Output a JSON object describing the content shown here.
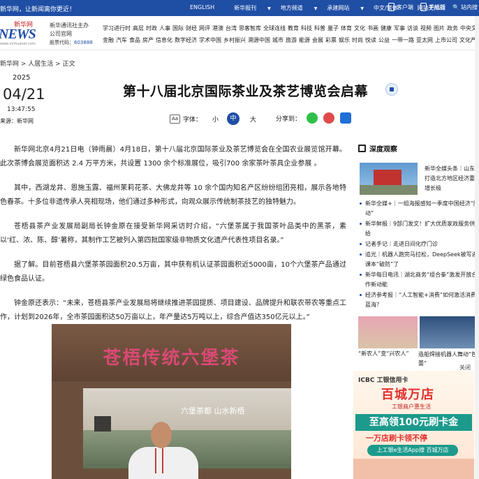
{
  "topbar": {
    "welcome": "新华网，让新闻离你更近！",
    "links": [
      "ENGLISH",
      "新华报刊",
      "地方频道",
      "承建网站",
      "中文/繁体",
      "网站无障碍"
    ],
    "apps": [
      "客户端",
      "手机版",
      "站内搜"
    ]
  },
  "brand": {
    "xhw": "新华网",
    "news": "NEWS",
    "url": "www.xinhuanet.com",
    "agency": "新华通讯社主办",
    "official": "公司官网",
    "code_label": "股票代码：",
    "code": "603888"
  },
  "channels": {
    "row1": [
      "学习进行时",
      "高层",
      "时政",
      "人事",
      "国际",
      "财经",
      "网评",
      "港澳",
      "台湾",
      "思客智库",
      "全球连线",
      "教育",
      "科技",
      "科普",
      "量子",
      "体育",
      "文化",
      "书画",
      "健康",
      "军事",
      "访谈",
      "视频",
      "图片",
      "政务",
      "中央文件"
    ],
    "row2": [
      "金融",
      "汽车",
      "食品",
      "房产",
      "信息化",
      "数字经济",
      "学术中国",
      "乡村振兴",
      "溯源中国",
      "城市",
      "旅游",
      "能源",
      "会展",
      "彩票",
      "娱乐",
      "时尚",
      "悦读",
      "公益",
      "一带一路",
      "亚太网",
      "上市公司",
      "文化产业"
    ]
  },
  "breadcrumb": [
    "新华网",
    "人居生活",
    "正文"
  ],
  "date": {
    "year": "2025",
    "md": "04/21",
    "time": "13:47:55",
    "source": "来源：新华网"
  },
  "article": {
    "title": "第十八届北京国际茶业及茶艺博览会启幕",
    "font_label": "字体：",
    "font_small": "小",
    "font_mid": "中",
    "font_large": "大",
    "share_label": "分享到：",
    "paragraphs": [
      "新华网北京4月21日电（钟雨晨）4月18日，第十八届北京国际茶业及茶艺博览会在全国农业展览馆开幕。此次茶博会展览面积达 2.4 万平方米，共设置 1300 余个标准展位，吸引700 余家茶叶茶具企业参展 。",
      "其中，西湖龙井、恩施玉露、福州茉莉花茶、大佛龙井等 10 余个国内知名产区纷纷组团亮相，展示各地特色春茶。十多位非遗传承人亮相现场，他们通过多种形式，向观众展示传统制茶技艺的独特魅力。",
      "苍梧县茶产业发展局副局长钟金原在接受新华网采访时介绍，“六堡茶属于我国茶叶品类中的黑茶，素以‘红、浓、陈、醇’著称，其制作工艺被列入第四批国家级非物质文化遗产代表性项目名录。”",
      "据了解。目前苍梧县六堡茶茶园面积20.5万亩，其中获有机认证茶园面积近5000亩，10个六堡茶产品通过绿色食品认证。",
      "钟金原还表示：“未来，苍梧县茶产业发展局将继续推进茶园提质、项目建设、品牌提升和联农带农等重点工作，计划到2026年，全市茶园面积达50万亩以上，年产量达5万吨以上，综合产值达350亿元以上。”"
    ],
    "photo_banner": "苍梧传统六堡茶",
    "photo_screen": "六堡茶都 山水新梧"
  },
  "sidebar": {
    "heading": "深度观察",
    "top_text": "新华全媒头条｜山东：打造北方地区经济重要增长极",
    "items": [
      "新华全媒+｜一组海报感知一季度中国经济“脉动”",
      "新华鲜报｜9部门发文！扩大优质家政服务供给",
      "记者手记｜走进日间化疗门诊",
      "追光｜机器人跑完马拉松，DeepSeek被写进课本“破防”了",
      "新华每日电讯｜湖北商务“组合拳”激发开放合作新动能",
      "经济参考报｜“人工智能+消费”如何激活消费蓝海？"
    ],
    "cap_a": "“新农人”变“兴农人”",
    "cap_b": "造船焊接机器人舞动“芭蕾”",
    "close": "关闭",
    "ad": {
      "brand": "ICBC 工银信用卡",
      "slogan": "百城万店",
      "sub": "工银商户惠生活",
      "big": "至高领100元刷卡金",
      "big2": "一万店刷卡领不停",
      "bar": "上工银e生活App搜 百城万店"
    }
  }
}
